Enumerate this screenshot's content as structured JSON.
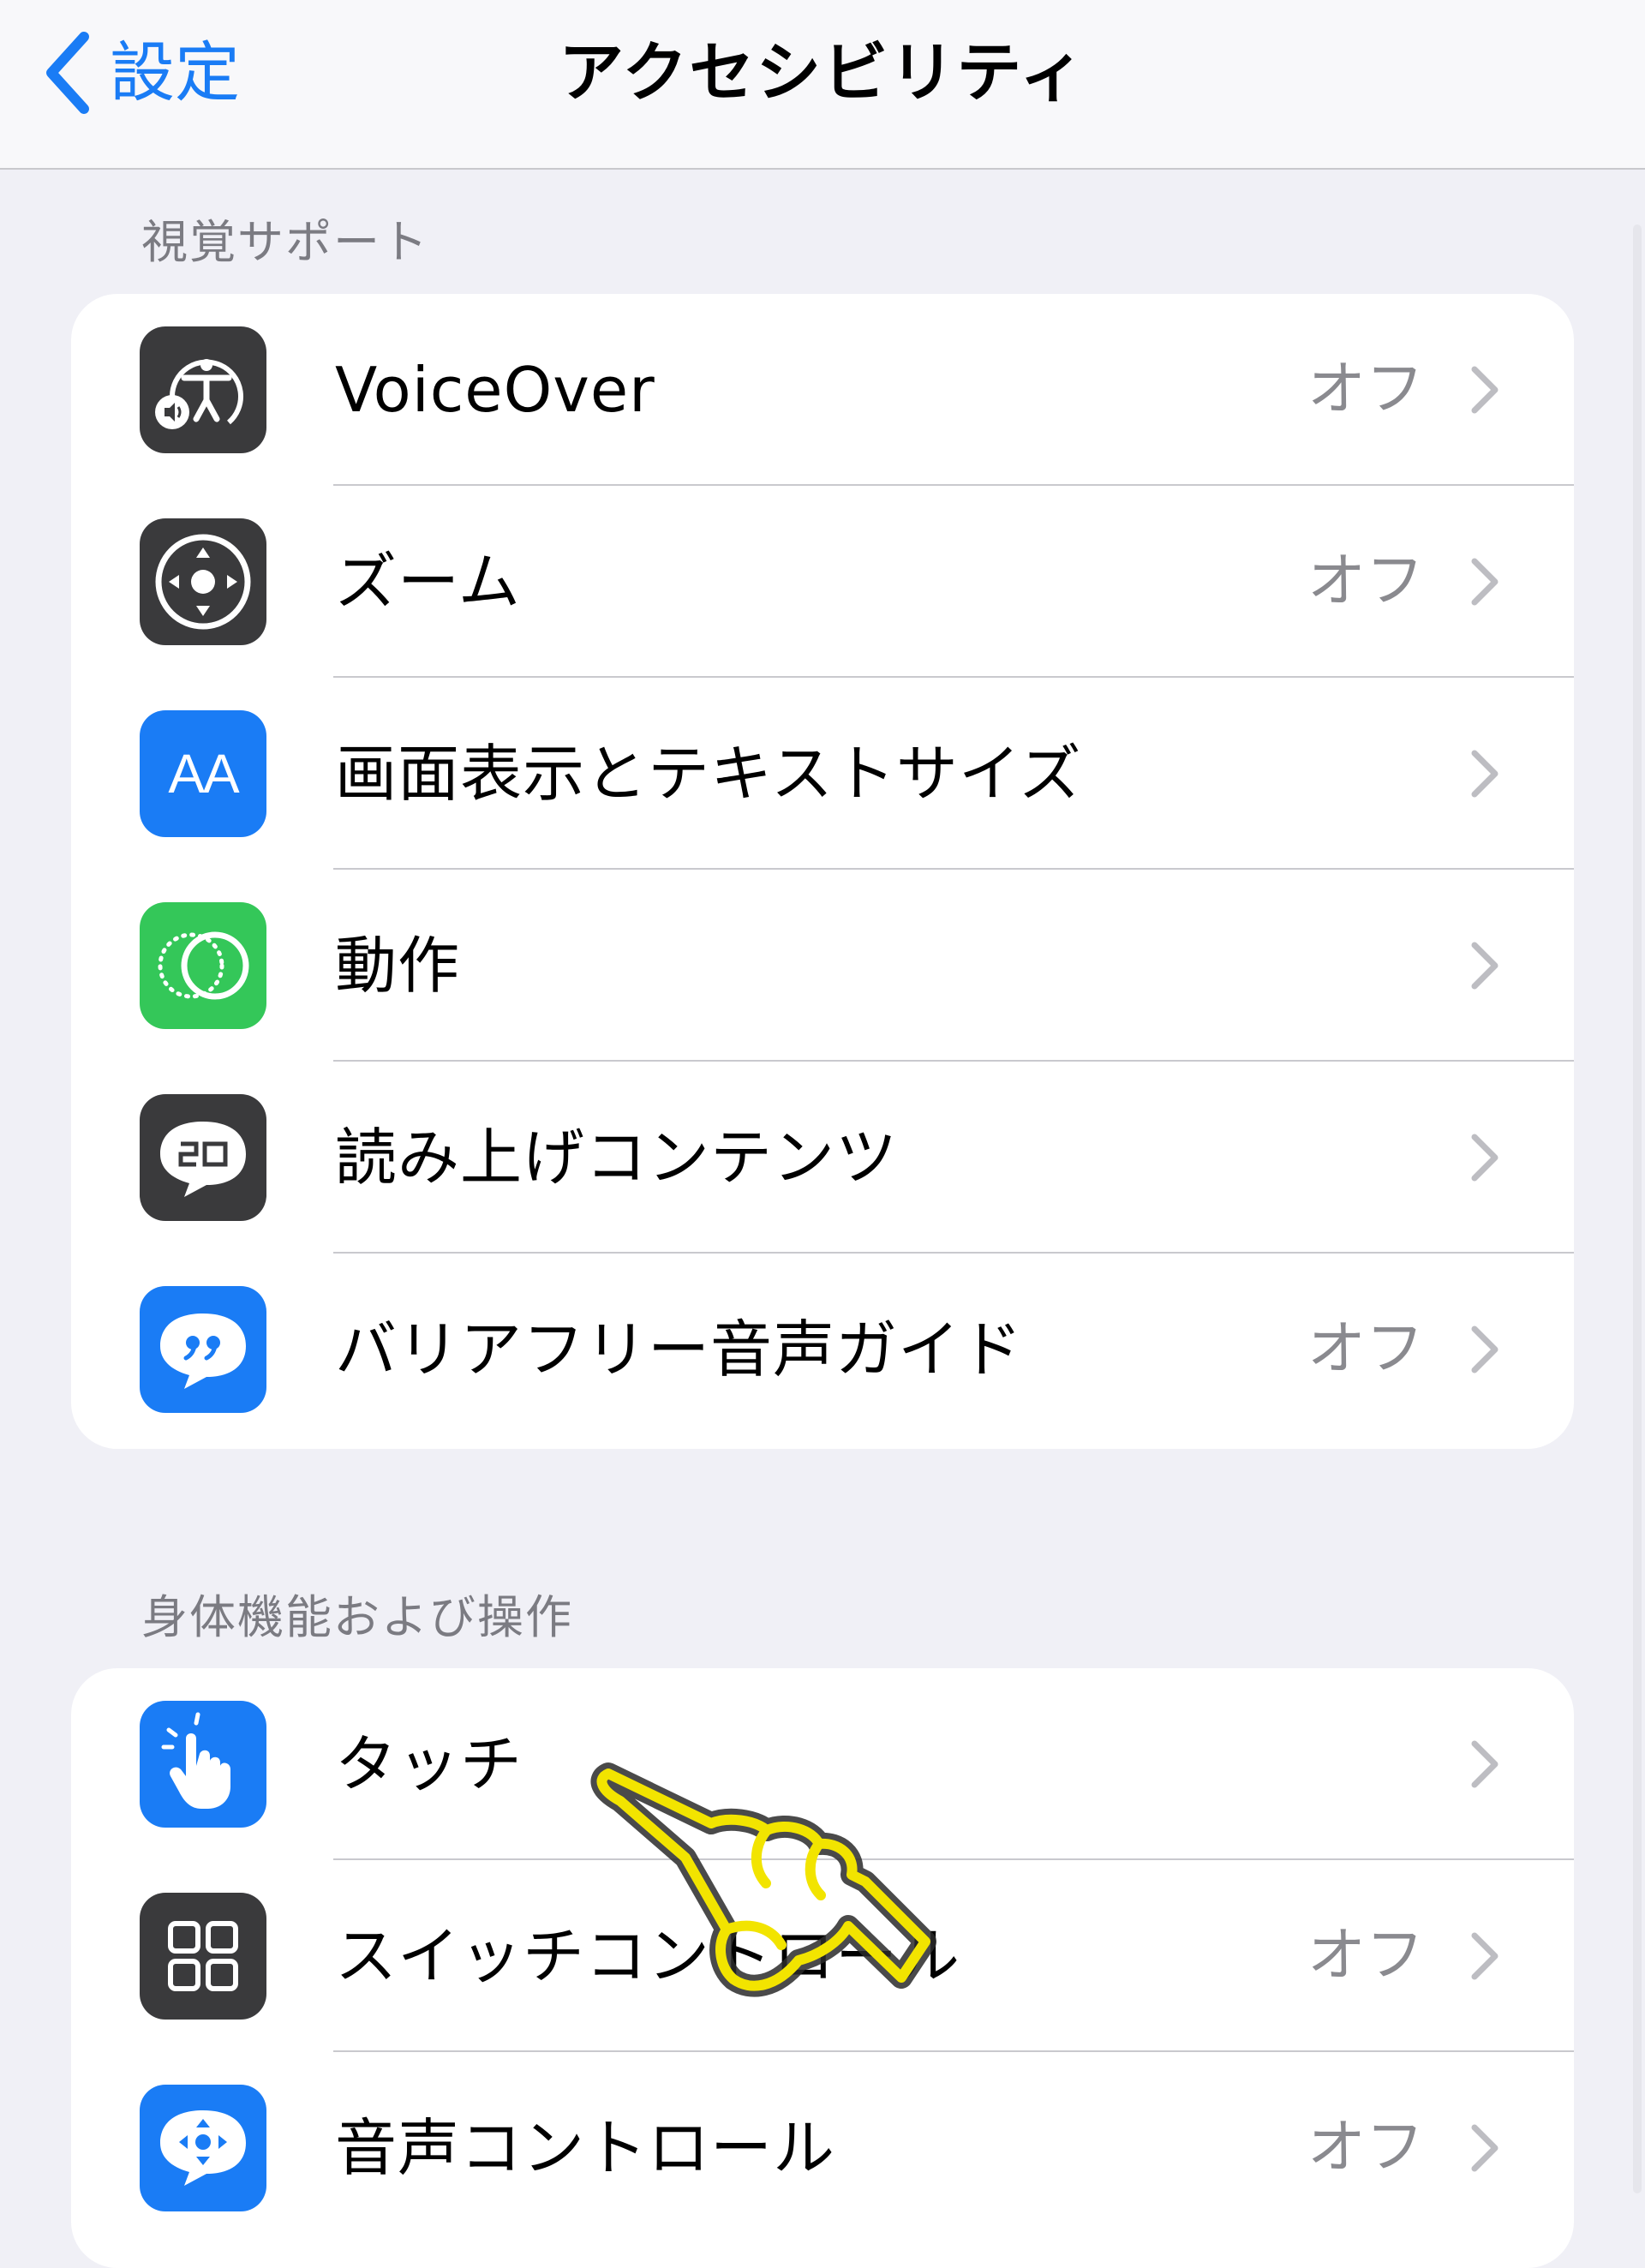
{
  "nav": {
    "back_label": "設定",
    "title": "アクセシビリティ"
  },
  "sections": [
    {
      "header": "視覚サポート",
      "rows": [
        {
          "label": "VoiceOver",
          "value": "オフ",
          "icon": "voiceover-icon",
          "icon_color": "#3a3a3c"
        },
        {
          "label": "ズーム",
          "value": "オフ",
          "icon": "zoom-icon",
          "icon_color": "#3a3a3c"
        },
        {
          "label": "画面表示とテキストサイズ",
          "value": "",
          "icon": "display-text-size-icon",
          "icon_color": "#1a7cf5",
          "icon_text": "AA"
        },
        {
          "label": "動作",
          "value": "",
          "icon": "motion-icon",
          "icon_color": "#34c759"
        },
        {
          "label": "読み上げコンテンツ",
          "value": "",
          "icon": "spoken-content-icon",
          "icon_color": "#3a3a3c"
        },
        {
          "label": "バリアフリー音声ガイド",
          "value": "オフ",
          "icon": "audio-descriptions-icon",
          "icon_color": "#1a7cf5"
        }
      ]
    },
    {
      "header": "身体機能および操作",
      "rows": [
        {
          "label": "タッチ",
          "value": "",
          "icon": "touch-icon",
          "icon_color": "#1a7cf5"
        },
        {
          "label": "スイッチコントロール",
          "value": "オフ",
          "icon": "switch-control-icon",
          "icon_color": "#3a3a3c"
        },
        {
          "label": "音声コントロール",
          "value": "オフ",
          "icon": "voice-control-icon",
          "icon_color": "#1a7cf5"
        }
      ]
    }
  ],
  "colors": {
    "accent": "#1a7cf5",
    "background": "#f0f0f6",
    "secondary_text": "#8a8a8f",
    "pointer_highlight": "#f2e400"
  }
}
